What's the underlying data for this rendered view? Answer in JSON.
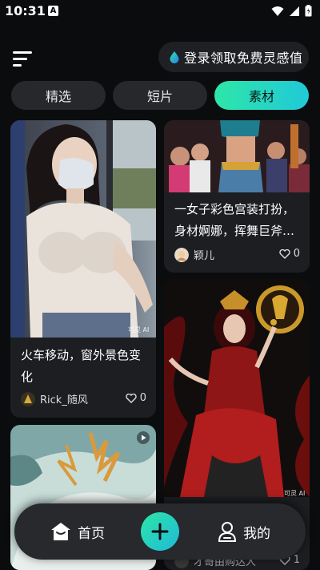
{
  "status_bar": {
    "time": "10:31",
    "notification_icon": "A"
  },
  "header": {
    "login_prompt": "登录领取免费灵感值"
  },
  "tabs": [
    {
      "label": "精选",
      "active": false
    },
    {
      "label": "短片",
      "active": false
    },
    {
      "label": "素材",
      "active": true
    }
  ],
  "feed": {
    "cards": [
      {
        "caption": "火车移动，窗外景色变化",
        "author": "Rick_随风",
        "likes": "0",
        "watermark": "可灵 AI"
      },
      {
        "caption": "一女子彩色宫装打扮，身材婀娜，挥舞巨斧…",
        "author": "颖儿",
        "likes": "0"
      },
      {
        "watermark": "可灵 AI"
      },
      {},
      {
        "author_partial": "才哥由购达人",
        "likes_partial": "1"
      }
    ]
  },
  "bottom_nav": {
    "home_label": "首页",
    "mine_label": "我的"
  },
  "colors": {
    "accent_start": "#2ee6a8",
    "accent_end": "#20c9d8",
    "background": "#0b0c0e",
    "card": "#1c1e21"
  }
}
